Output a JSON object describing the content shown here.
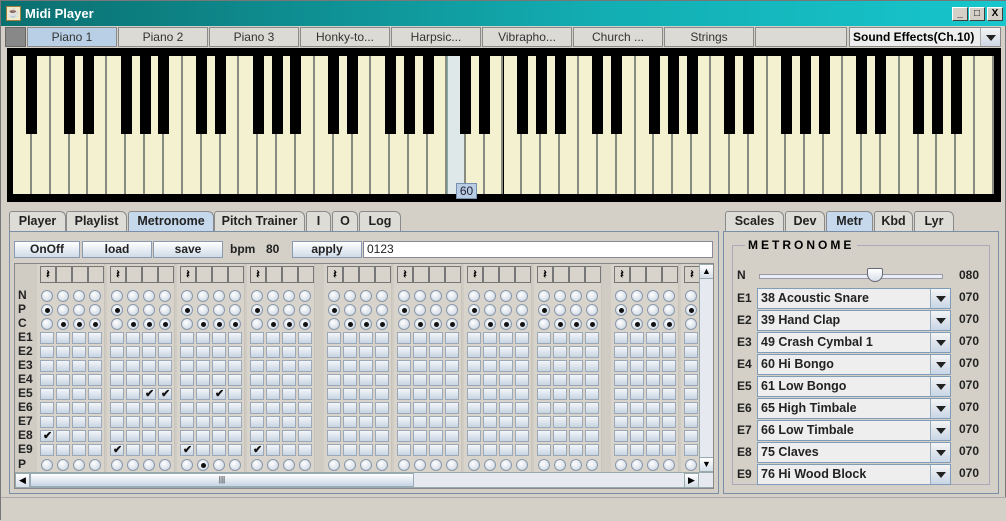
{
  "window": {
    "title": "Midi Player",
    "icon": "java-cup-icon",
    "controls": [
      "_",
      "□",
      "X"
    ]
  },
  "instruments": {
    "tabs": [
      "Piano 1",
      "Piano 2",
      "Piano 3",
      "Honky-to...",
      "Harpsic...",
      "Vibrapho...",
      "Church ...",
      "Strings",
      ""
    ],
    "selected": 0,
    "channel": "Sound Effects(Ch.10)"
  },
  "piano": {
    "first_note": "A0",
    "white_keys": 52,
    "hovered_note": 60,
    "tooltip": "60"
  },
  "left_tabs": {
    "items": [
      "Player",
      "Playlist",
      "Metronome",
      "Pitch Trainer",
      "I",
      "O",
      "Log"
    ],
    "selected": 2
  },
  "toolbar": {
    "onoff": "OnOff",
    "load": "load",
    "save": "save",
    "bpm_label": "bpm",
    "bpm": "80",
    "apply": "apply",
    "sequence": "0123"
  },
  "grid": {
    "rows": [
      "N",
      "P",
      "C",
      "E1",
      "E2",
      "E3",
      "E4",
      "E5",
      "E6",
      "E7",
      "E8",
      "E9",
      "P"
    ],
    "measures": 10,
    "beats": 4,
    "header_symbol": "𝄽",
    "P_selected_beat": 1,
    "C_selected_beats": [
      2,
      3,
      4
    ],
    "checked": [
      {
        "row": "E8",
        "measure": 1,
        "beat": 1
      },
      {
        "row": "E5",
        "measure": 2,
        "beat": 3
      },
      {
        "row": "E5",
        "measure": 2,
        "beat": 4
      },
      {
        "row": "E5",
        "measure": 3,
        "beat": 3
      },
      {
        "row": "E9",
        "measure": 2,
        "beat": 1
      },
      {
        "row": "E9",
        "measure": 3,
        "beat": 1
      },
      {
        "row": "E9",
        "measure": 4,
        "beat": 1
      }
    ],
    "position": {
      "measure": 3,
      "beat": 2
    }
  },
  "right_tabs": {
    "items": [
      "Scales",
      "Dev",
      "Metr",
      "Kbd",
      "Lyr"
    ],
    "selected": 2
  },
  "metronome": {
    "title": "METRONOME",
    "n_label": "N",
    "n_value": "080",
    "n_slider_percent": 63,
    "rows": [
      {
        "label": "E1",
        "instrument": "38  Acoustic Snare",
        "volume": "070"
      },
      {
        "label": "E2",
        "instrument": "39  Hand Clap",
        "volume": "070"
      },
      {
        "label": "E3",
        "instrument": "49  Crash Cymbal 1",
        "volume": "070"
      },
      {
        "label": "E4",
        "instrument": "60  Hi Bongo",
        "volume": "070"
      },
      {
        "label": "E5",
        "instrument": "61  Low Bongo",
        "volume": "070"
      },
      {
        "label": "E6",
        "instrument": "65  High Timbale",
        "volume": "070"
      },
      {
        "label": "E7",
        "instrument": "66  Low Timbale",
        "volume": "070"
      },
      {
        "label": "E8",
        "instrument": "75  Claves",
        "volume": "070"
      },
      {
        "label": "E9",
        "instrument": "76  Hi Wood Block",
        "volume": "070"
      }
    ]
  }
}
